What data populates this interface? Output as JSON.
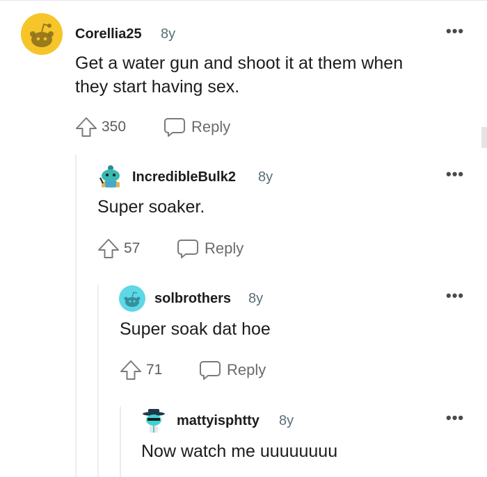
{
  "comments": [
    {
      "username": "Corellia25",
      "age": "8y",
      "body_lines": [
        "Get a water gun and shoot it at them when",
        "they start having sex."
      ],
      "votes": "350",
      "reply_label": "Reply",
      "more_label": "•••",
      "avatar_color": "#f6c52a"
    },
    {
      "username": "IncredibleBulk2",
      "age": "8y",
      "body_lines": [
        "Super soaker."
      ],
      "votes": "57",
      "reply_label": "Reply",
      "more_label": "•••",
      "avatar_color": "#3ab8b2"
    },
    {
      "username": "solbrothers",
      "age": "8y",
      "body_lines": [
        "Super soak dat hoe"
      ],
      "votes": "71",
      "reply_label": "Reply",
      "more_label": "•••",
      "avatar_color": "#5ed8e6"
    },
    {
      "username": "mattyisphtty",
      "age": "8y",
      "body_lines": [
        "Now watch me uuuuuuuu"
      ],
      "more_label": "•••",
      "avatar_color": "#3fd3d3"
    }
  ],
  "icons": {
    "upvote": "upvote-icon",
    "reply": "reply-icon",
    "more": "more-options-icon"
  }
}
